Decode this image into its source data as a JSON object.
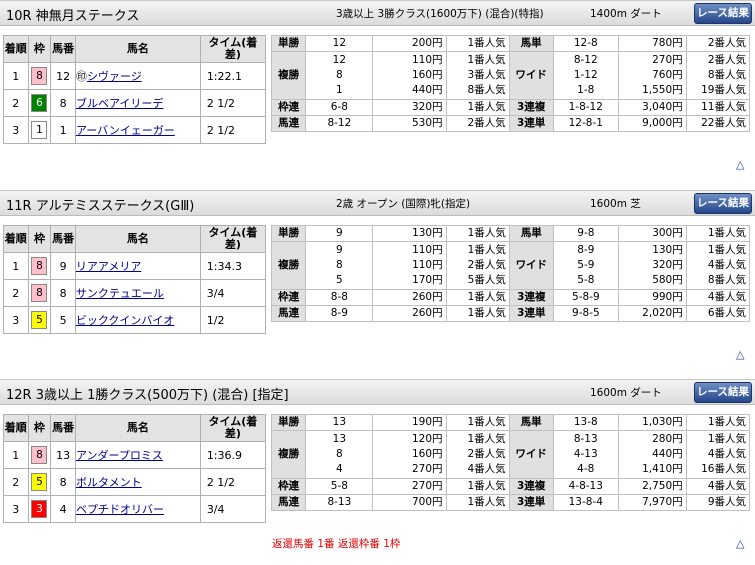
{
  "common": {
    "button_label": "レース結果",
    "headers": {
      "rank": "着順",
      "frame": "枠",
      "num": "馬番",
      "name": "馬名",
      "time": "タイム(着差)"
    },
    "triangle": "△"
  },
  "races": [
    {
      "title": "10R 神無月ステークス",
      "conditions": "3歳以上 3勝クラス(1600万下) (混合)(特指)",
      "distance": "1400m ダート",
      "horses": [
        {
          "rank": "1",
          "frame": "8",
          "frame_bg": "#ffc0cb",
          "frame_fg": "#000000",
          "num": "12",
          "prefix": "㊞",
          "name": "シヴァージ",
          "time": "1:22.1"
        },
        {
          "rank": "2",
          "frame": "6",
          "frame_bg": "#008000",
          "frame_fg": "#ffffff",
          "num": "8",
          "prefix": "",
          "name": "ブルベアイリーデ",
          "time": "2 1/2"
        },
        {
          "rank": "3",
          "frame": "1",
          "frame_bg": "#ffffff",
          "frame_fg": "#000000",
          "num": "1",
          "prefix": "",
          "name": "アーバンイェーガー",
          "time": "2 1/2"
        }
      ],
      "payout_rows": [
        {
          "l_label": "単勝",
          "l_combo": [
            "12"
          ],
          "l_amt": [
            "200円"
          ],
          "l_pop": [
            "1番人気"
          ],
          "r_label": "馬単",
          "r_combo": [
            "12-8"
          ],
          "r_amt": [
            "780円"
          ],
          "r_pop": [
            "2番人気"
          ]
        },
        {
          "l_label": "複勝",
          "l_combo": [
            "12",
            "8",
            "1"
          ],
          "l_amt": [
            "110円",
            "160円",
            "440円"
          ],
          "l_pop": [
            "1番人気",
            "3番人気",
            "8番人気"
          ],
          "r_label": "ワイド",
          "r_combo": [
            "8-12",
            "1-12",
            "1-8"
          ],
          "r_amt": [
            "270円",
            "760円",
            "1,550円"
          ],
          "r_pop": [
            "2番人気",
            "8番人気",
            "19番人気"
          ]
        },
        {
          "l_label": "枠連",
          "l_combo": [
            "6-8"
          ],
          "l_amt": [
            "320円"
          ],
          "l_pop": [
            "1番人気"
          ],
          "r_label": "3連複",
          "r_combo": [
            "1-8-12"
          ],
          "r_amt": [
            "3,040円"
          ],
          "r_pop": [
            "11番人気"
          ]
        },
        {
          "l_label": "馬連",
          "l_combo": [
            "8-12"
          ],
          "l_amt": [
            "530円"
          ],
          "l_pop": [
            "2番人気"
          ],
          "r_label": "3連単",
          "r_combo": [
            "12-8-1"
          ],
          "r_amt": [
            "9,000円"
          ],
          "r_pop": [
            "22番人気"
          ]
        }
      ]
    },
    {
      "title": "11R アルテミスステークス(GⅢ)",
      "conditions": "2歳 オープン (国際)牝(指定)",
      "distance": "1600m 芝",
      "horses": [
        {
          "rank": "1",
          "frame": "8",
          "frame_bg": "#ffc0cb",
          "frame_fg": "#000000",
          "num": "9",
          "prefix": "",
          "name": "リアアメリア",
          "time": "1:34.3"
        },
        {
          "rank": "2",
          "frame": "8",
          "frame_bg": "#ffc0cb",
          "frame_fg": "#000000",
          "num": "8",
          "prefix": "",
          "name": "サンクテュエール",
          "time": "3/4"
        },
        {
          "rank": "3",
          "frame": "5",
          "frame_bg": "#ffff00",
          "frame_fg": "#000000",
          "num": "5",
          "prefix": "",
          "name": "ビッククインバイオ",
          "time": "1/2"
        }
      ],
      "payout_rows": [
        {
          "l_label": "単勝",
          "l_combo": [
            "9"
          ],
          "l_amt": [
            "130円"
          ],
          "l_pop": [
            "1番人気"
          ],
          "r_label": "馬単",
          "r_combo": [
            "9-8"
          ],
          "r_amt": [
            "300円"
          ],
          "r_pop": [
            "1番人気"
          ]
        },
        {
          "l_label": "複勝",
          "l_combo": [
            "9",
            "8",
            "5"
          ],
          "l_amt": [
            "110円",
            "110円",
            "170円"
          ],
          "l_pop": [
            "1番人気",
            "2番人気",
            "5番人気"
          ],
          "r_label": "ワイド",
          "r_combo": [
            "8-9",
            "5-9",
            "5-8"
          ],
          "r_amt": [
            "130円",
            "320円",
            "580円"
          ],
          "r_pop": [
            "1番人気",
            "4番人気",
            "8番人気"
          ]
        },
        {
          "l_label": "枠連",
          "l_combo": [
            "8-8"
          ],
          "l_amt": [
            "260円"
          ],
          "l_pop": [
            "1番人気"
          ],
          "r_label": "3連複",
          "r_combo": [
            "5-8-9"
          ],
          "r_amt": [
            "990円"
          ],
          "r_pop": [
            "4番人気"
          ]
        },
        {
          "l_label": "馬連",
          "l_combo": [
            "8-9"
          ],
          "l_amt": [
            "260円"
          ],
          "l_pop": [
            "1番人気"
          ],
          "r_label": "3連単",
          "r_combo": [
            "9-8-5"
          ],
          "r_amt": [
            "2,020円"
          ],
          "r_pop": [
            "6番人気"
          ]
        }
      ]
    },
    {
      "title": "12R 3歳以上 1勝クラス(500万下) (混合) [指定]",
      "conditions": "",
      "distance": "1600m ダート",
      "horses": [
        {
          "rank": "1",
          "frame": "8",
          "frame_bg": "#ffc0cb",
          "frame_fg": "#000000",
          "num": "13",
          "prefix": "",
          "name": "アンダープロミス",
          "time": "1:36.9"
        },
        {
          "rank": "2",
          "frame": "5",
          "frame_bg": "#ffff00",
          "frame_fg": "#000000",
          "num": "8",
          "prefix": "",
          "name": "ボルタメント",
          "time": "2 1/2"
        },
        {
          "rank": "3",
          "frame": "3",
          "frame_bg": "#ff0000",
          "frame_fg": "#ffffff",
          "num": "4",
          "prefix": "",
          "name": "ベプチドオリバー",
          "time": "3/4"
        }
      ],
      "payout_rows": [
        {
          "l_label": "単勝",
          "l_combo": [
            "13"
          ],
          "l_amt": [
            "190円"
          ],
          "l_pop": [
            "1番人気"
          ],
          "r_label": "馬単",
          "r_combo": [
            "13-8"
          ],
          "r_amt": [
            "1,030円"
          ],
          "r_pop": [
            "1番人気"
          ]
        },
        {
          "l_label": "複勝",
          "l_combo": [
            "13",
            "8",
            "4"
          ],
          "l_amt": [
            "120円",
            "160円",
            "270円"
          ],
          "l_pop": [
            "1番人気",
            "2番人気",
            "4番人気"
          ],
          "r_label": "ワイド",
          "r_combo": [
            "8-13",
            "4-13",
            "4-8"
          ],
          "r_amt": [
            "280円",
            "440円",
            "1,410円"
          ],
          "r_pop": [
            "1番人気",
            "4番人気",
            "16番人気"
          ]
        },
        {
          "l_label": "枠連",
          "l_combo": [
            "5-8"
          ],
          "l_amt": [
            "270円"
          ],
          "l_pop": [
            "1番人気"
          ],
          "r_label": "3連複",
          "r_combo": [
            "4-8-13"
          ],
          "r_amt": [
            "2,750円"
          ],
          "r_pop": [
            "4番人気"
          ]
        },
        {
          "l_label": "馬連",
          "l_combo": [
            "8-13"
          ],
          "l_amt": [
            "700円"
          ],
          "l_pop": [
            "1番人気"
          ],
          "r_label": "3連単",
          "r_combo": [
            "13-8-4"
          ],
          "r_amt": [
            "7,970円"
          ],
          "r_pop": [
            "9番人気"
          ]
        }
      ],
      "note": "返還馬番 1番 返還枠番 1枠"
    }
  ]
}
